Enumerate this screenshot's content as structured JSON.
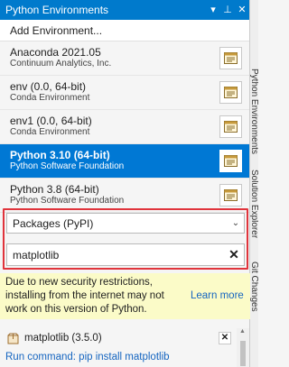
{
  "window": {
    "title": "Python Environments"
  },
  "title_controls": [
    "▾",
    "⊥",
    "✕"
  ],
  "add_environment": "Add Environment...",
  "environments": [
    {
      "name": "Anaconda 2021.05",
      "sub": "Continuum Analytics, Inc.",
      "selected": false
    },
    {
      "name": "env (0.0, 64-bit)",
      "sub": "Conda Environment",
      "selected": false
    },
    {
      "name": "env1 (0.0, 64-bit)",
      "sub": "Conda Environment",
      "selected": false
    },
    {
      "name": "Python 3.10 (64-bit)",
      "sub": "Python Software Foundation",
      "selected": true
    },
    {
      "name": "Python 3.8 (64-bit)",
      "sub": "Python Software Foundation",
      "selected": false
    }
  ],
  "packages_dropdown": {
    "value": "Packages (PyPI)"
  },
  "search": {
    "value": "matplotlib"
  },
  "warning": {
    "message": "Due to new security restrictions, installing from the internet may not work on this version of Python.",
    "learn_more": "Learn more"
  },
  "package_item": {
    "name": "matplotlib (3.5.0)"
  },
  "run_command": "Run command: pip install matplotlib",
  "side_tabs": [
    "Python Environments",
    "Solution Explorer",
    "Git Changes"
  ],
  "colors": {
    "accent": "#007acc",
    "selected": "#0078d4",
    "highlight": "#e0343c",
    "warning_bg": "#fbfbc8",
    "link": "#1565c0"
  }
}
